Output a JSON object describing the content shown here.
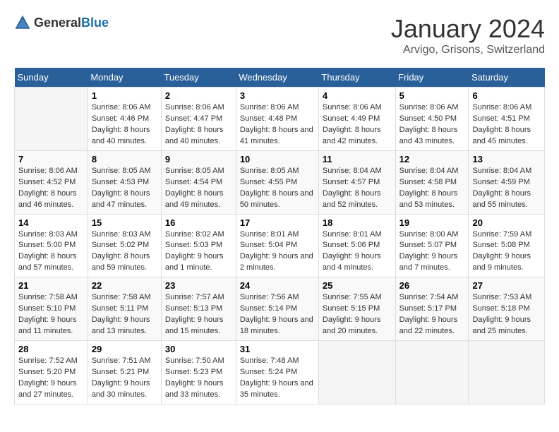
{
  "logo": {
    "text_general": "General",
    "text_blue": "Blue"
  },
  "title": "January 2024",
  "subtitle": "Arvigo, Grisons, Switzerland",
  "headers": [
    "Sunday",
    "Monday",
    "Tuesday",
    "Wednesday",
    "Thursday",
    "Friday",
    "Saturday"
  ],
  "weeks": [
    [
      {
        "day": "",
        "sunrise": "",
        "sunset": "",
        "daylight": ""
      },
      {
        "day": "1",
        "sunrise": "Sunrise: 8:06 AM",
        "sunset": "Sunset: 4:46 PM",
        "daylight": "Daylight: 8 hours and 40 minutes."
      },
      {
        "day": "2",
        "sunrise": "Sunrise: 8:06 AM",
        "sunset": "Sunset: 4:47 PM",
        "daylight": "Daylight: 8 hours and 40 minutes."
      },
      {
        "day": "3",
        "sunrise": "Sunrise: 8:06 AM",
        "sunset": "Sunset: 4:48 PM",
        "daylight": "Daylight: 8 hours and 41 minutes."
      },
      {
        "day": "4",
        "sunrise": "Sunrise: 8:06 AM",
        "sunset": "Sunset: 4:49 PM",
        "daylight": "Daylight: 8 hours and 42 minutes."
      },
      {
        "day": "5",
        "sunrise": "Sunrise: 8:06 AM",
        "sunset": "Sunset: 4:50 PM",
        "daylight": "Daylight: 8 hours and 43 minutes."
      },
      {
        "day": "6",
        "sunrise": "Sunrise: 8:06 AM",
        "sunset": "Sunset: 4:51 PM",
        "daylight": "Daylight: 8 hours and 45 minutes."
      }
    ],
    [
      {
        "day": "7",
        "sunrise": "Sunrise: 8:06 AM",
        "sunset": "Sunset: 4:52 PM",
        "daylight": "Daylight: 8 hours and 46 minutes."
      },
      {
        "day": "8",
        "sunrise": "Sunrise: 8:05 AM",
        "sunset": "Sunset: 4:53 PM",
        "daylight": "Daylight: 8 hours and 47 minutes."
      },
      {
        "day": "9",
        "sunrise": "Sunrise: 8:05 AM",
        "sunset": "Sunset: 4:54 PM",
        "daylight": "Daylight: 8 hours and 49 minutes."
      },
      {
        "day": "10",
        "sunrise": "Sunrise: 8:05 AM",
        "sunset": "Sunset: 4:55 PM",
        "daylight": "Daylight: 8 hours and 50 minutes."
      },
      {
        "day": "11",
        "sunrise": "Sunrise: 8:04 AM",
        "sunset": "Sunset: 4:57 PM",
        "daylight": "Daylight: 8 hours and 52 minutes."
      },
      {
        "day": "12",
        "sunrise": "Sunrise: 8:04 AM",
        "sunset": "Sunset: 4:58 PM",
        "daylight": "Daylight: 8 hours and 53 minutes."
      },
      {
        "day": "13",
        "sunrise": "Sunrise: 8:04 AM",
        "sunset": "Sunset: 4:59 PM",
        "daylight": "Daylight: 8 hours and 55 minutes."
      }
    ],
    [
      {
        "day": "14",
        "sunrise": "Sunrise: 8:03 AM",
        "sunset": "Sunset: 5:00 PM",
        "daylight": "Daylight: 8 hours and 57 minutes."
      },
      {
        "day": "15",
        "sunrise": "Sunrise: 8:03 AM",
        "sunset": "Sunset: 5:02 PM",
        "daylight": "Daylight: 8 hours and 59 minutes."
      },
      {
        "day": "16",
        "sunrise": "Sunrise: 8:02 AM",
        "sunset": "Sunset: 5:03 PM",
        "daylight": "Daylight: 9 hours and 1 minute."
      },
      {
        "day": "17",
        "sunrise": "Sunrise: 8:01 AM",
        "sunset": "Sunset: 5:04 PM",
        "daylight": "Daylight: 9 hours and 2 minutes."
      },
      {
        "day": "18",
        "sunrise": "Sunrise: 8:01 AM",
        "sunset": "Sunset: 5:06 PM",
        "daylight": "Daylight: 9 hours and 4 minutes."
      },
      {
        "day": "19",
        "sunrise": "Sunrise: 8:00 AM",
        "sunset": "Sunset: 5:07 PM",
        "daylight": "Daylight: 9 hours and 7 minutes."
      },
      {
        "day": "20",
        "sunrise": "Sunrise: 7:59 AM",
        "sunset": "Sunset: 5:08 PM",
        "daylight": "Daylight: 9 hours and 9 minutes."
      }
    ],
    [
      {
        "day": "21",
        "sunrise": "Sunrise: 7:58 AM",
        "sunset": "Sunset: 5:10 PM",
        "daylight": "Daylight: 9 hours and 11 minutes."
      },
      {
        "day": "22",
        "sunrise": "Sunrise: 7:58 AM",
        "sunset": "Sunset: 5:11 PM",
        "daylight": "Daylight: 9 hours and 13 minutes."
      },
      {
        "day": "23",
        "sunrise": "Sunrise: 7:57 AM",
        "sunset": "Sunset: 5:13 PM",
        "daylight": "Daylight: 9 hours and 15 minutes."
      },
      {
        "day": "24",
        "sunrise": "Sunrise: 7:56 AM",
        "sunset": "Sunset: 5:14 PM",
        "daylight": "Daylight: 9 hours and 18 minutes."
      },
      {
        "day": "25",
        "sunrise": "Sunrise: 7:55 AM",
        "sunset": "Sunset: 5:15 PM",
        "daylight": "Daylight: 9 hours and 20 minutes."
      },
      {
        "day": "26",
        "sunrise": "Sunrise: 7:54 AM",
        "sunset": "Sunset: 5:17 PM",
        "daylight": "Daylight: 9 hours and 22 minutes."
      },
      {
        "day": "27",
        "sunrise": "Sunrise: 7:53 AM",
        "sunset": "Sunset: 5:18 PM",
        "daylight": "Daylight: 9 hours and 25 minutes."
      }
    ],
    [
      {
        "day": "28",
        "sunrise": "Sunrise: 7:52 AM",
        "sunset": "Sunset: 5:20 PM",
        "daylight": "Daylight: 9 hours and 27 minutes."
      },
      {
        "day": "29",
        "sunrise": "Sunrise: 7:51 AM",
        "sunset": "Sunset: 5:21 PM",
        "daylight": "Daylight: 9 hours and 30 minutes."
      },
      {
        "day": "30",
        "sunrise": "Sunrise: 7:50 AM",
        "sunset": "Sunset: 5:23 PM",
        "daylight": "Daylight: 9 hours and 33 minutes."
      },
      {
        "day": "31",
        "sunrise": "Sunrise: 7:48 AM",
        "sunset": "Sunset: 5:24 PM",
        "daylight": "Daylight: 9 hours and 35 minutes."
      },
      {
        "day": "",
        "sunrise": "",
        "sunset": "",
        "daylight": ""
      },
      {
        "day": "",
        "sunrise": "",
        "sunset": "",
        "daylight": ""
      },
      {
        "day": "",
        "sunrise": "",
        "sunset": "",
        "daylight": ""
      }
    ]
  ]
}
